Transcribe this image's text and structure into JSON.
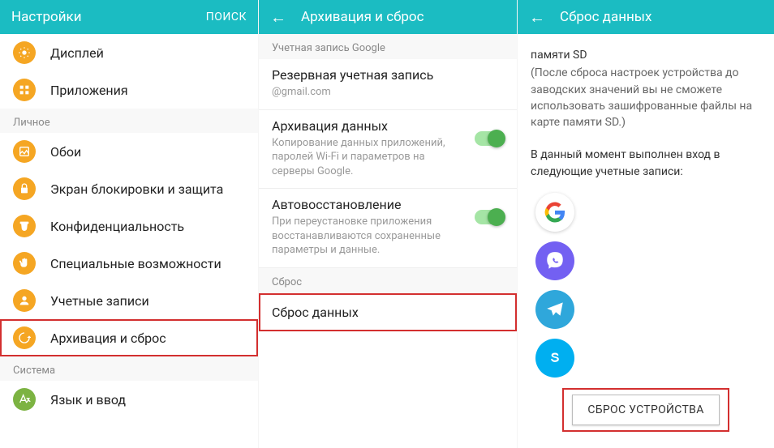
{
  "panel1": {
    "header_title": "Настройки",
    "header_search": "ПОИСК",
    "items_top": [
      {
        "label": "Дисплей",
        "icon": "display"
      },
      {
        "label": "Приложения",
        "icon": "apps"
      }
    ],
    "section_personal": "Личное",
    "items_personal": [
      {
        "label": "Обои",
        "icon": "wallpaper"
      },
      {
        "label": "Экран блокировки и защита",
        "icon": "lock"
      },
      {
        "label": "Конфиденциальность",
        "icon": "privacy"
      },
      {
        "label": "Специальные возможности",
        "icon": "hand"
      },
      {
        "label": "Учетные записи",
        "icon": "accounts"
      },
      {
        "label": "Архивация и сброс",
        "icon": "backup",
        "highlight": true
      }
    ],
    "section_system": "Система",
    "items_system": [
      {
        "label": "Язык и ввод",
        "icon": "language"
      }
    ]
  },
  "panel2": {
    "header_title": "Архивация и сброс",
    "section_google": "Учетная запись Google",
    "backup_account": {
      "title": "Резервная учетная запись",
      "desc": "@gmail.com"
    },
    "backup_data": {
      "title": "Архивация данных",
      "desc": "Копирование данных приложений, паролей Wi-Fi и параметров на серверы Google.",
      "toggle": true
    },
    "auto_restore": {
      "title": "Автовосстановление",
      "desc": "При переустановке приложения восстанавливаются сохраненные параметры и данные.",
      "toggle": true
    },
    "section_reset": "Сброс",
    "reset_data": {
      "title": "Сброс данных",
      "highlight": true
    }
  },
  "panel3": {
    "header_title": "Сброс данных",
    "memory_title": "памяти SD",
    "memory_desc": "(После сброса настроек устройства до заводских значений вы не сможете использовать зашифрованные файлы на карте памяти SD.)",
    "accounts_text": "В данный момент выполнен вход в следующие учетные записи:",
    "accounts": [
      "google",
      "viber",
      "telegram",
      "skype"
    ],
    "reset_button": "СБРОС УСТРОЙСТВА"
  }
}
